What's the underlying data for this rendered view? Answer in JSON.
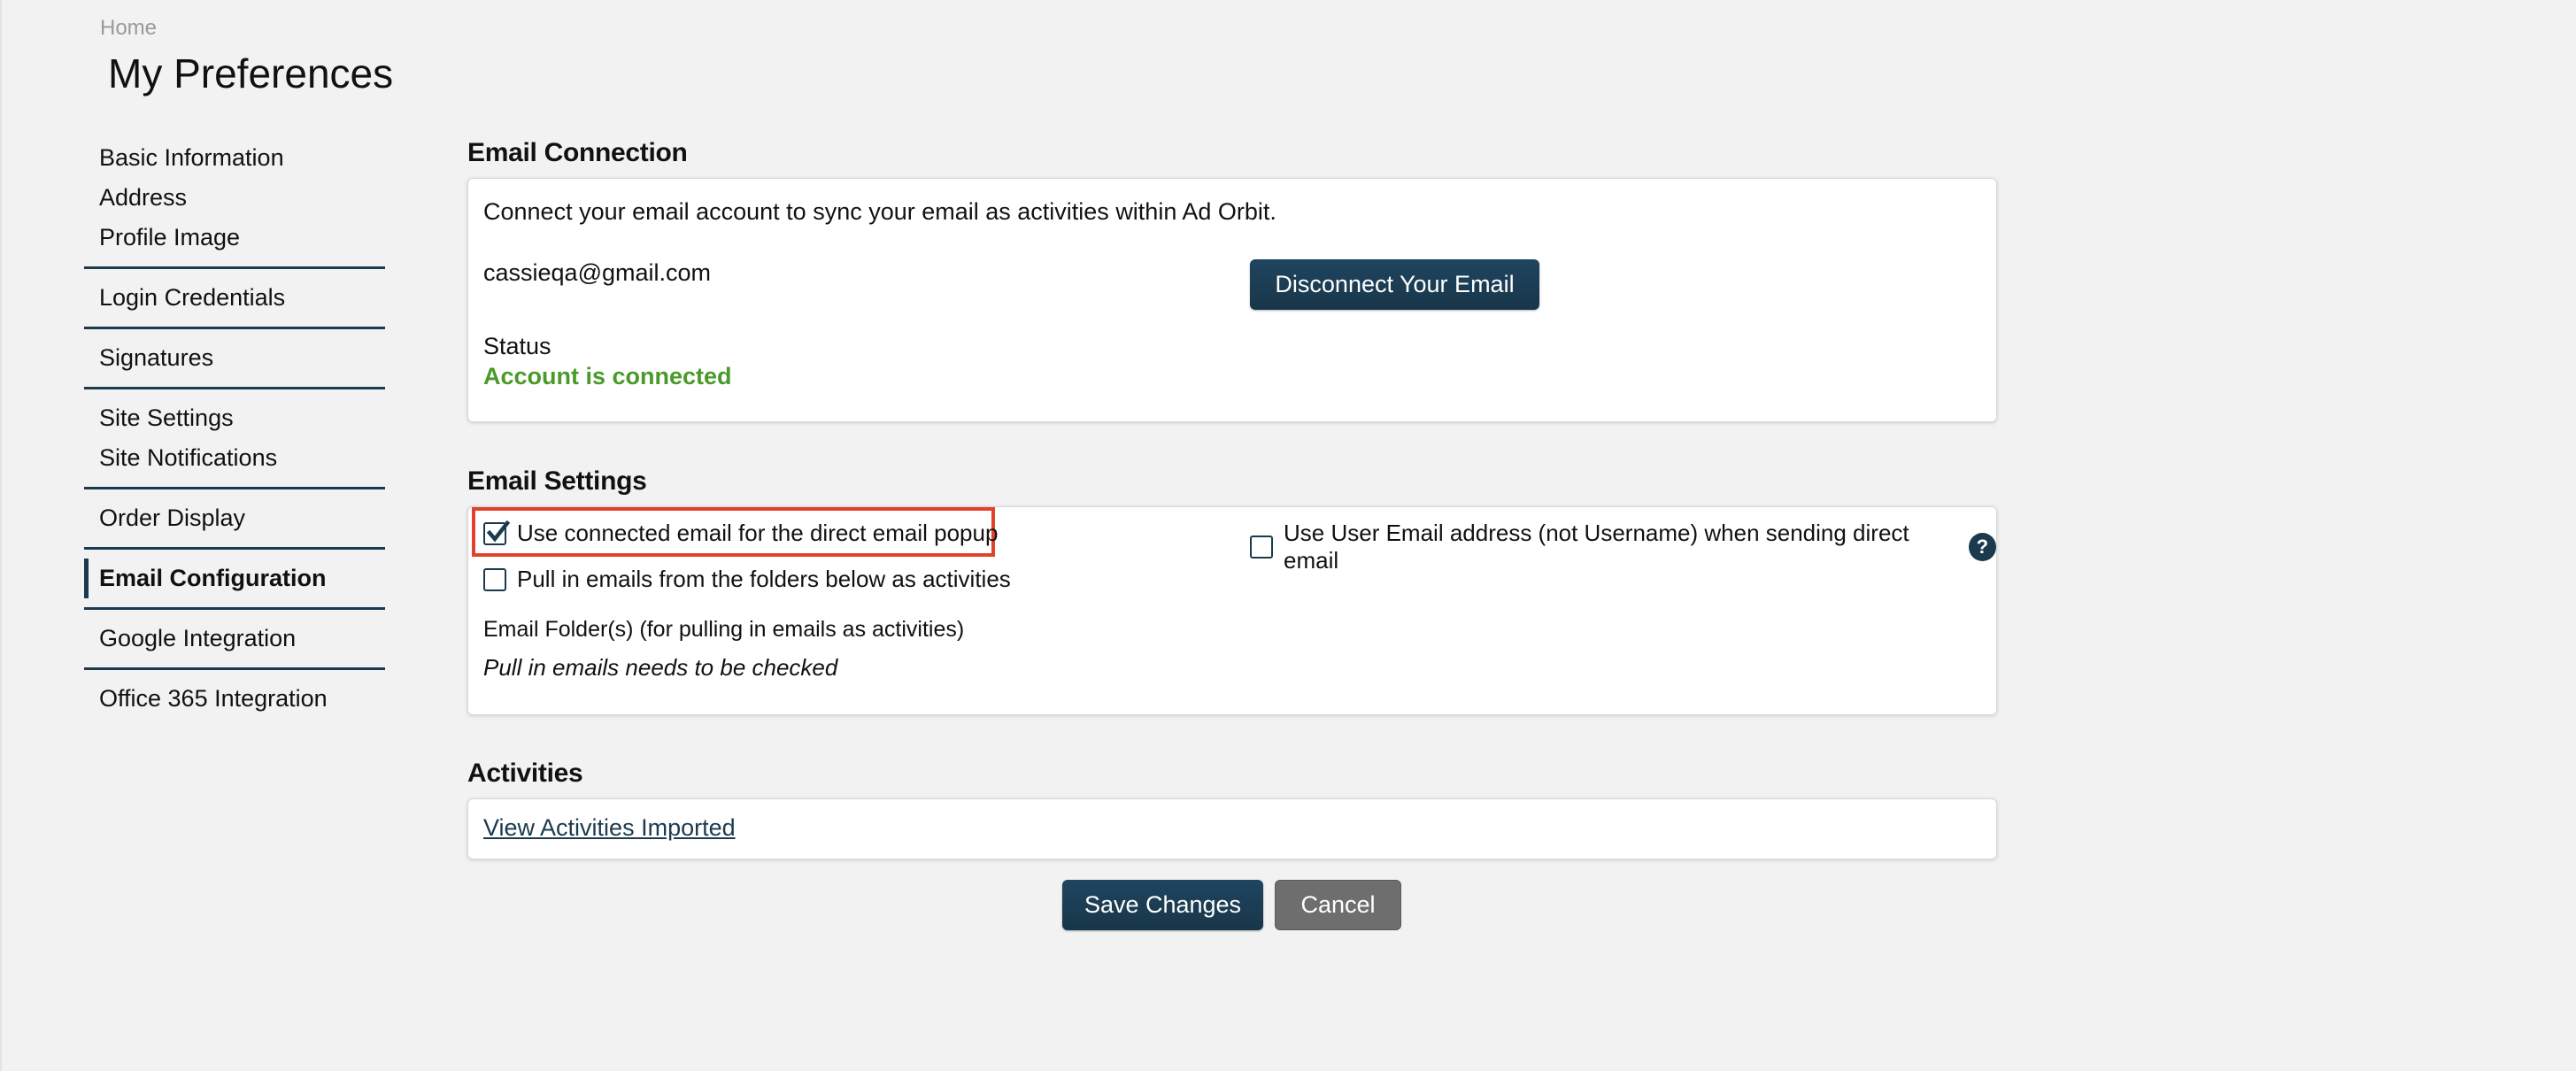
{
  "breadcrumb": {
    "home": "Home"
  },
  "page": {
    "title": "My Preferences"
  },
  "sidebar": {
    "groups": [
      [
        "Basic Information",
        "Address",
        "Profile Image"
      ],
      [
        "Login Credentials"
      ],
      [
        "Signatures"
      ],
      [
        "Site Settings",
        "Site Notifications"
      ],
      [
        "Order Display"
      ],
      [
        "Email Configuration"
      ],
      [
        "Google Integration"
      ],
      [
        "Office 365 Integration"
      ]
    ],
    "active": "Email Configuration"
  },
  "email_connection": {
    "heading": "Email Connection",
    "description": "Connect your email account to sync your email as activities within Ad Orbit.",
    "email": "cassieqa@gmail.com",
    "disconnect_label": "Disconnect Your Email",
    "status_label": "Status",
    "status_value": "Account is connected",
    "status_color": "#4a9a2a"
  },
  "email_settings": {
    "heading": "Email Settings",
    "use_connected_label": "Use connected email for the direct email popup",
    "use_connected_checked": true,
    "use_user_email_label": "Use User Email address (not Username) when sending direct email",
    "use_user_email_checked": false,
    "help_icon": "question-circle-icon",
    "pull_in_label": "Pull in emails from the folders below as activities",
    "pull_in_checked": false,
    "folders_label": "Email Folder(s) (for pulling in emails as activities)",
    "folders_note": "Pull in emails needs to be checked"
  },
  "activities": {
    "heading": "Activities",
    "view_link": "View Activities Imported"
  },
  "actions": {
    "save_label": "Save Changes",
    "cancel_label": "Cancel"
  },
  "colors": {
    "primary": "#1b3a4e",
    "highlight": "#e2412b",
    "background": "#f2f2f2"
  }
}
